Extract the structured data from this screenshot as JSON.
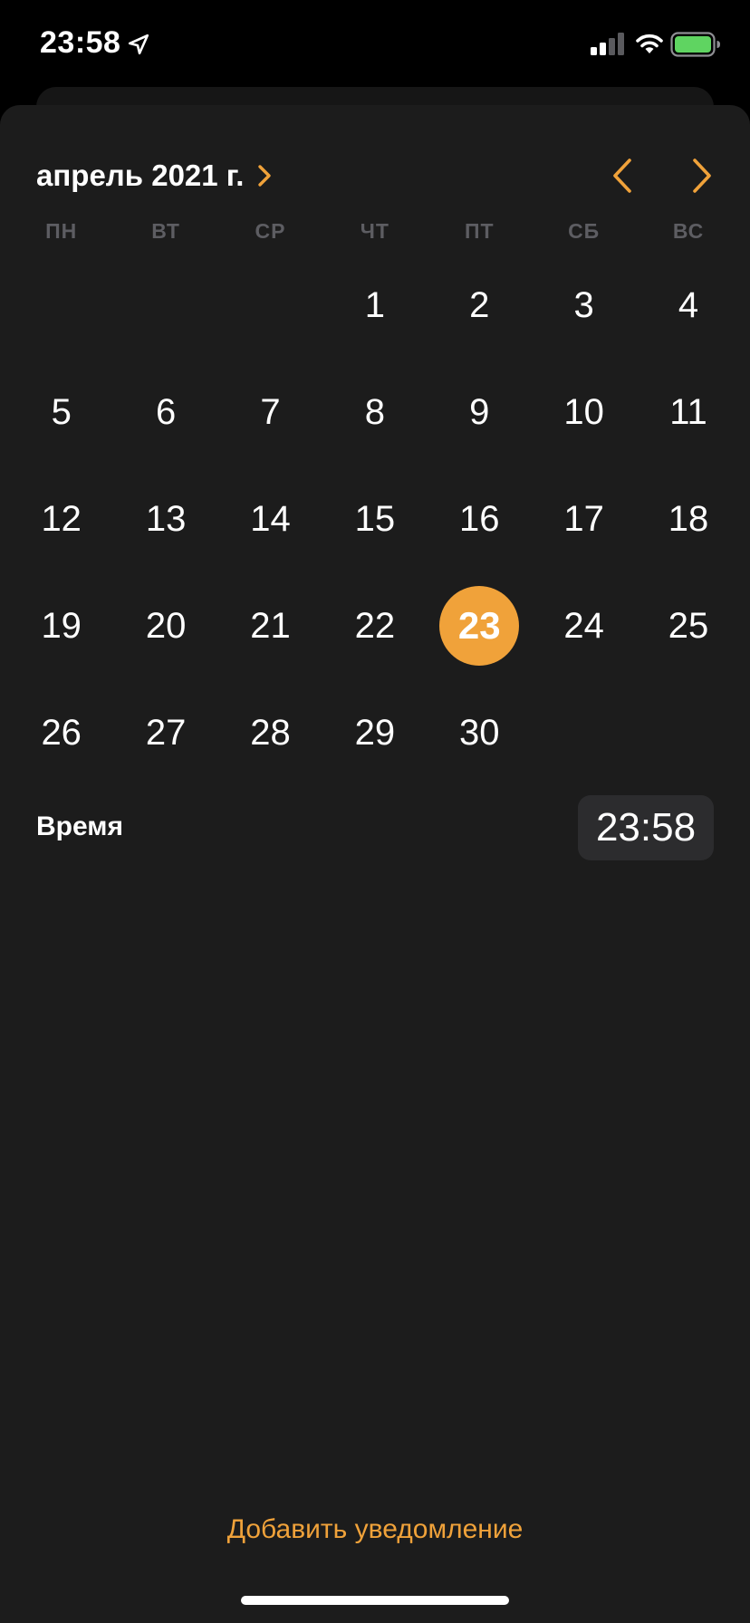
{
  "status_bar": {
    "time": "23:58",
    "icons": [
      "location-arrow-icon",
      "cellular-signal-icon",
      "wifi-icon",
      "battery-icon"
    ]
  },
  "calendar": {
    "month_title": "апрель 2021 г.",
    "weekdays": [
      "ПН",
      "ВТ",
      "СР",
      "ЧТ",
      "ПТ",
      "СБ",
      "ВС"
    ],
    "weeks": [
      [
        "",
        "",
        "",
        "1",
        "2",
        "3",
        "4"
      ],
      [
        "5",
        "6",
        "7",
        "8",
        "9",
        "10",
        "11"
      ],
      [
        "12",
        "13",
        "14",
        "15",
        "16",
        "17",
        "18"
      ],
      [
        "19",
        "20",
        "21",
        "22",
        "23",
        "24",
        "25"
      ],
      [
        "26",
        "27",
        "28",
        "29",
        "30",
        "",
        ""
      ]
    ],
    "selected_day": "23"
  },
  "time_row": {
    "label": "Время",
    "value": "23:58"
  },
  "add_notification_label": "Добавить уведомление",
  "colors": {
    "accent": "#f0a23a",
    "sheet_background": "#1c1c1c",
    "weekday_text": "#5d5d62",
    "time_pill": "#2c2c2e"
  }
}
